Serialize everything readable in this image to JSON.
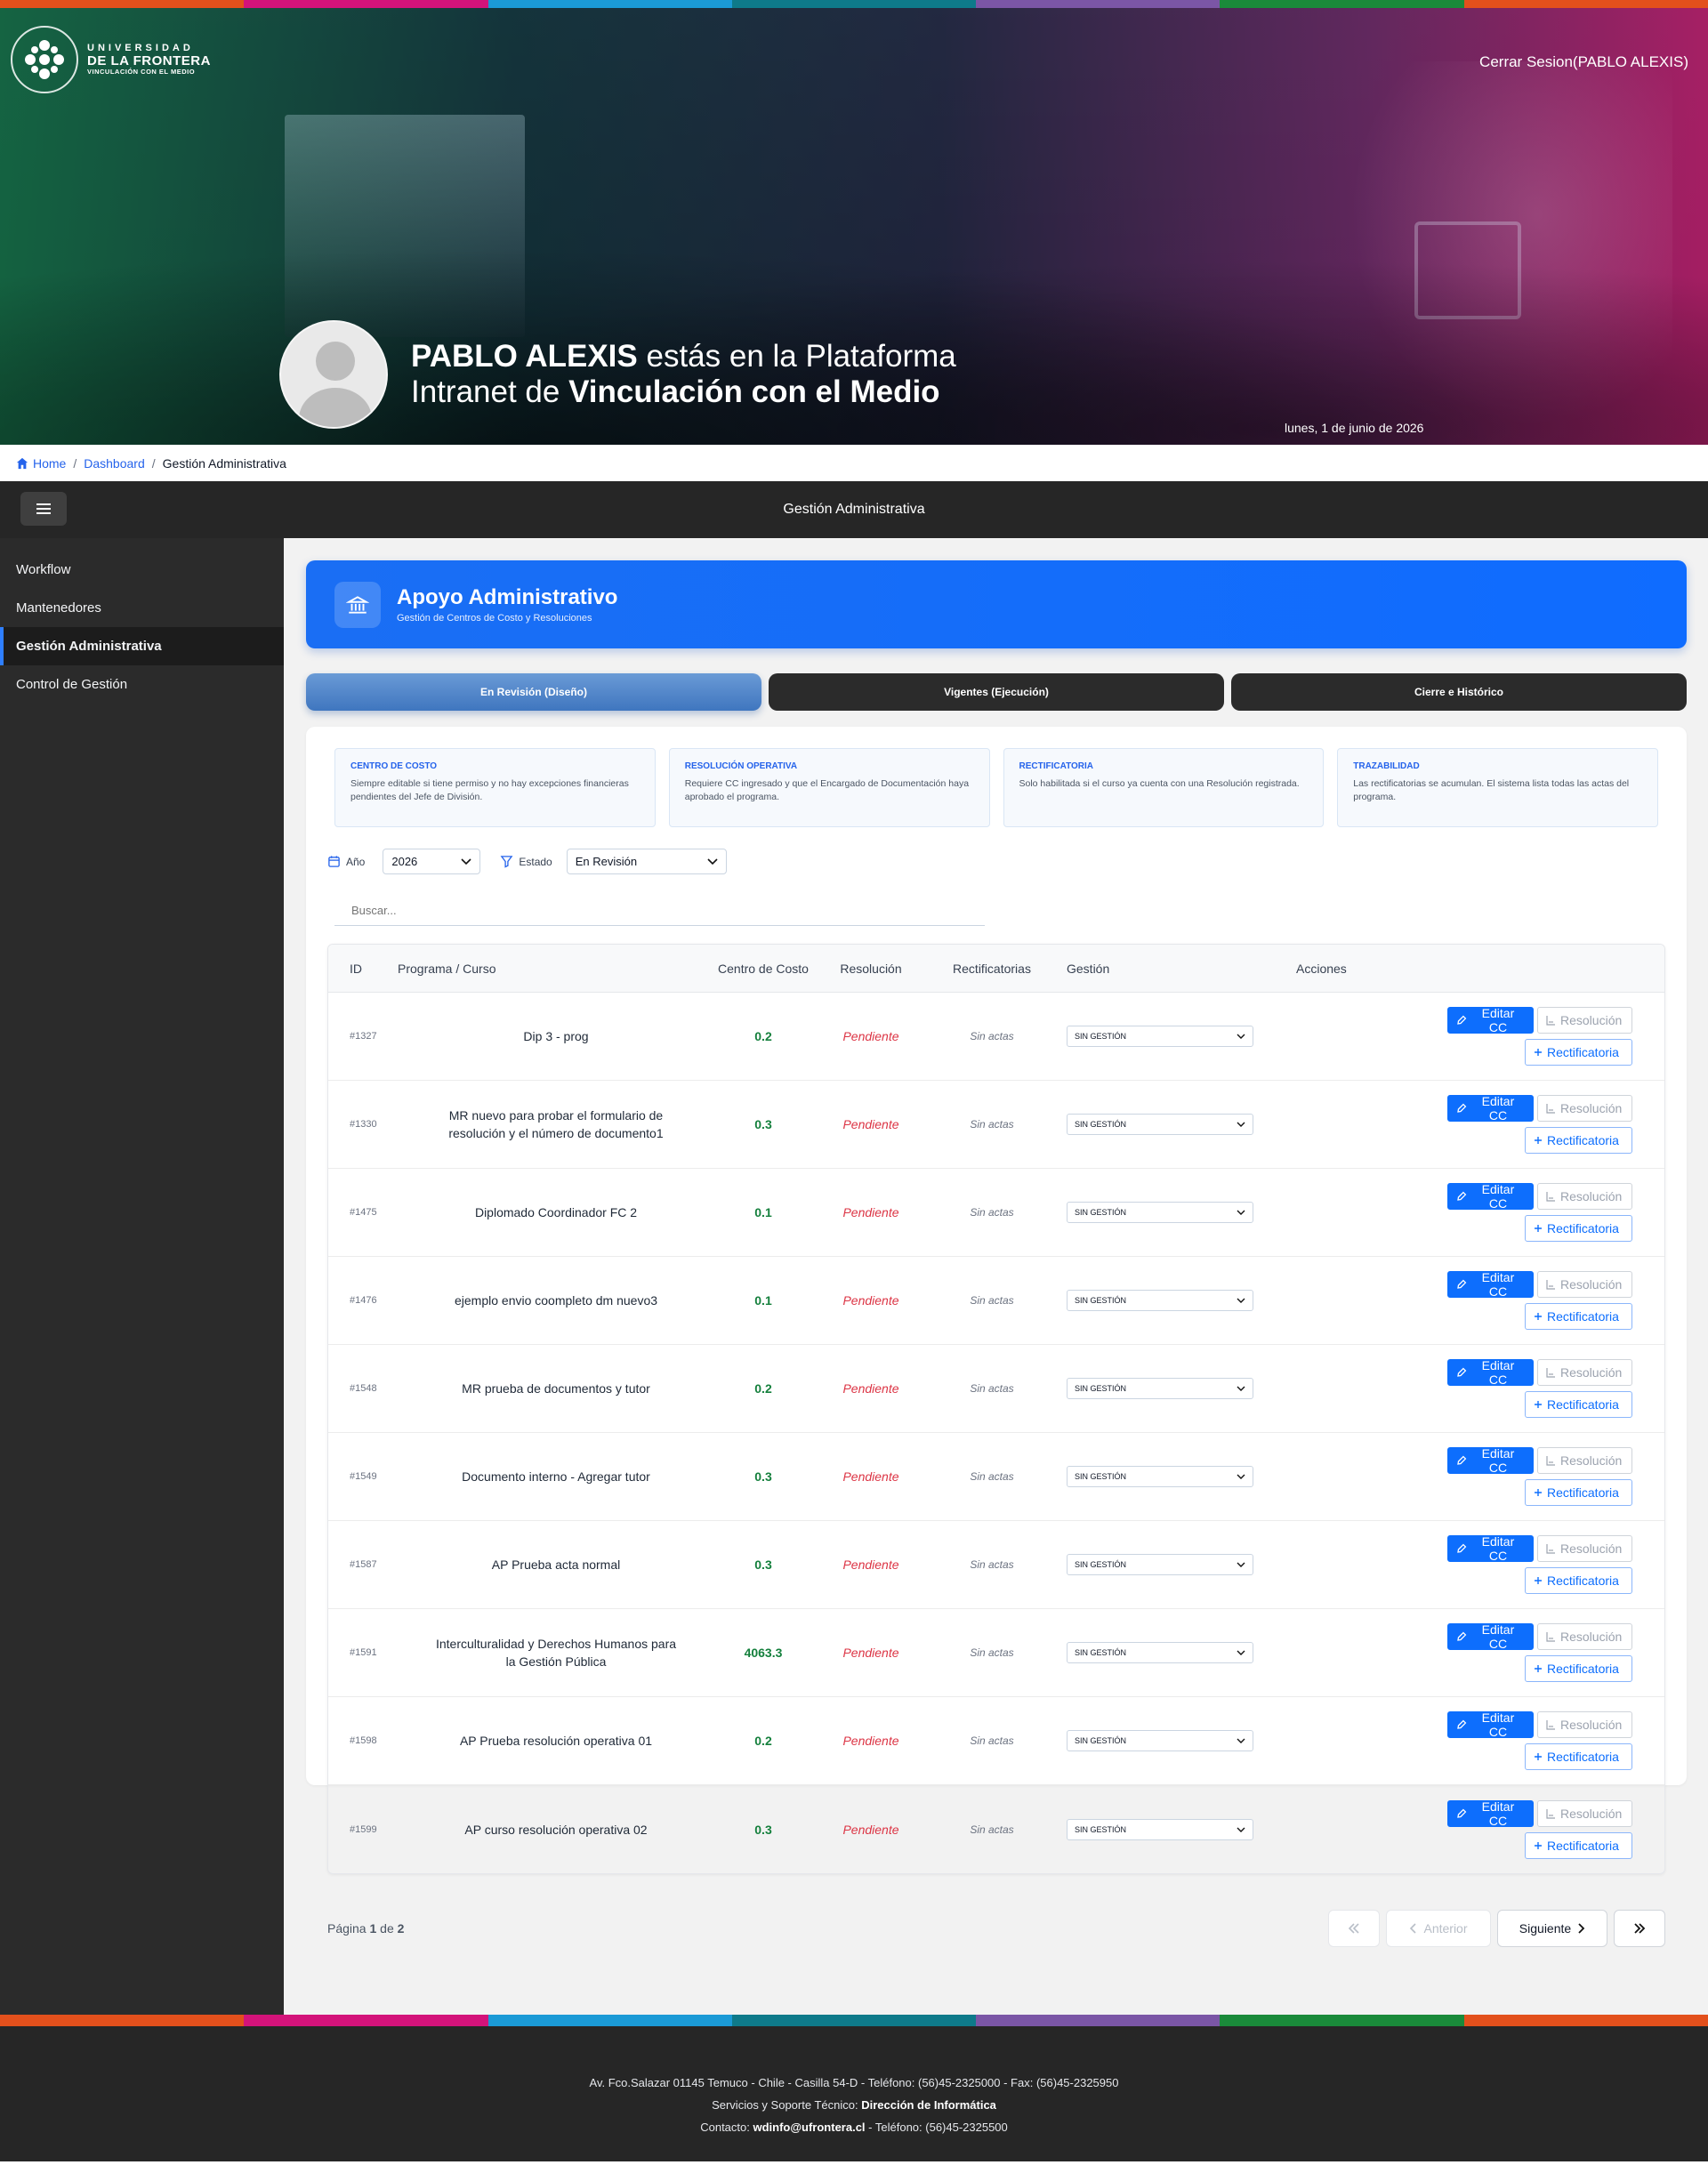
{
  "colors": {
    "strip": [
      "#e3501c",
      "#d3137a",
      "#1b9ad6",
      "#0e7a8a",
      "#7b56a6",
      "#1a8a3a",
      "#e3501c"
    ],
    "accent": "#0d6efd",
    "sidebar": "#2b2b2b",
    "pending": "#dc3545",
    "cost_center": "#15803d"
  },
  "header": {
    "logo": {
      "line1": "UNIVERSIDAD",
      "line2": "DE LA FRONTERA",
      "line3": "VINCULACIÓN CON EL MEDIO"
    },
    "logout": "Cerrar Sesion(PABLO ALEXIS)",
    "greeting": {
      "name": "PABLO ALEXIS",
      "text1": " estás en la Plataforma",
      "text2": "Intranet de ",
      "strong": "Vinculación con el Medio"
    },
    "date": "lunes, 1 de junio de 2026"
  },
  "breadcrumb": {
    "home": "Home",
    "dashboard": "Dashboard",
    "current": "Gestión Administrativa",
    "sep": "/"
  },
  "appbar": {
    "title": "Gestión Administrativa",
    "menu_icon": "hamburger-icon"
  },
  "sidebar": {
    "items": [
      {
        "label": "Workflow"
      },
      {
        "label": "Mantenedores"
      },
      {
        "label": "Gestión Administrativa",
        "active": true
      },
      {
        "label": "Control de Gestión"
      }
    ]
  },
  "hero_card": {
    "icon": "bank-icon",
    "title": "Apoyo Administrativo",
    "subtitle": "Gestión de Centros de Costo y Resoluciones"
  },
  "tabs": [
    {
      "label": "En Revisión (Diseño)",
      "active": true
    },
    {
      "label": "Vigentes (Ejecución)"
    },
    {
      "label": "Cierre e Histórico"
    }
  ],
  "info_cards": [
    {
      "title": "CENTRO DE COSTO",
      "text": "Siempre editable si tiene permiso y no hay excepciones financieras pendientes del Jefe de División."
    },
    {
      "title": "RESOLUCIÓN OPERATIVA",
      "text": "Requiere CC ingresado y que el Encargado de Documentación haya aprobado el programa."
    },
    {
      "title": "RECTIFICATORIA",
      "text": "Solo habilitada si el curso ya cuenta con una Resolución registrada."
    },
    {
      "title": "TRAZABILIDAD",
      "text": "Las rectificatorias se acumulan. El sistema lista todas las actas del programa."
    }
  ],
  "filters": {
    "year_label": "Año",
    "year_value": "2026",
    "status_label": "Estado",
    "status_value": "En Revisión"
  },
  "search": {
    "placeholder": "Buscar..."
  },
  "table": {
    "headers": {
      "id": "ID",
      "program": "Programa / Curso",
      "cc": "Centro de Costo",
      "resolution": "Resolución",
      "rect": "Rectificatorias",
      "gestion": "Gestión",
      "actions": "Acciones"
    },
    "labels": {
      "pending": "Pendiente",
      "no_acts": "Sin actas",
      "gestion": "SIN GESTIÓN",
      "edit_cc": "Editar CC",
      "resolution": "Resolución",
      "rectificatoria": "Rectificatoria"
    },
    "rows": [
      {
        "id": "#1327",
        "program": "Dip 3 - prog",
        "cc": "0.2"
      },
      {
        "id": "#1330",
        "program": "MR nuevo para probar el formulario de resolución y el número de documento1",
        "cc": "0.3"
      },
      {
        "id": "#1475",
        "program": "Diplomado Coordinador FC 2",
        "cc": "0.1"
      },
      {
        "id": "#1476",
        "program": "ejemplo envio coompleto dm nuevo3",
        "cc": "0.1"
      },
      {
        "id": "#1548",
        "program": "MR prueba de documentos y tutor",
        "cc": "0.2"
      },
      {
        "id": "#1549",
        "program": "Documento interno - Agregar tutor",
        "cc": "0.3"
      },
      {
        "id": "#1587",
        "program": "AP Prueba acta normal",
        "cc": "0.3"
      },
      {
        "id": "#1591",
        "program": "Interculturalidad y Derechos Humanos para la Gestión Pública",
        "cc": "4063.3"
      },
      {
        "id": "#1598",
        "program": "AP Prueba resolución operativa 01",
        "cc": "0.2"
      },
      {
        "id": "#1599",
        "program": "AP curso resolución operativa 02",
        "cc": "0.3"
      }
    ]
  },
  "pagination": {
    "label_page": "Página ",
    "current": "1",
    "of": " de ",
    "total": "2",
    "prev": "Anterior",
    "next": "Siguiente"
  },
  "footer": {
    "address": "Av. Fco.Salazar 01145 Temuco - Chile - Casilla 54-D - Teléfono: (56)45-2325000 - Fax: (56)45-2325950",
    "support_prefix": "Servicios y Soporte Técnico: ",
    "support_strong": "Dirección de Informática",
    "contact_prefix": "Contacto: ",
    "contact_email": "wdinfo@ufrontera.cl",
    "contact_suffix": " - Teléfono: (56)45-2325500"
  }
}
